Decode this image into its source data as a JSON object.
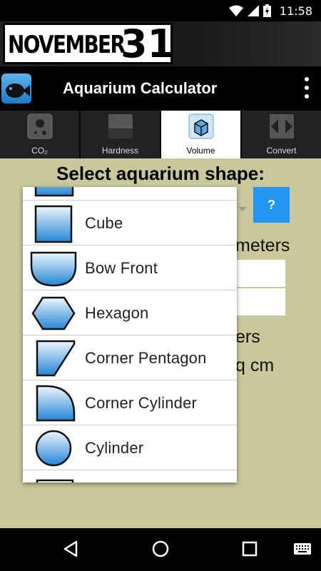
{
  "status_bar": {
    "time": "11:58"
  },
  "banner": {
    "month": "NOVEMBER",
    "day": "31"
  },
  "app_bar": {
    "title": "Aquarium Calculator"
  },
  "tabs": [
    {
      "label": "CO₂",
      "selected": false
    },
    {
      "label": "Hardness",
      "selected": false
    },
    {
      "label": "Volume",
      "selected": true
    },
    {
      "label": "Convert",
      "selected": false
    }
  ],
  "content": {
    "heading": "Select aquarium shape:",
    "help_label": "?",
    "units_text": "meters",
    "area_text_1": "ers",
    "area_text_2": "q cm"
  },
  "shape_dropdown": {
    "options": [
      {
        "label": "Cube",
        "icon": "cube-shape-icon"
      },
      {
        "label": "Bow Front",
        "icon": "bow-front-shape-icon"
      },
      {
        "label": "Hexagon",
        "icon": "hexagon-shape-icon"
      },
      {
        "label": "Corner Pentagon",
        "icon": "corner-pentagon-shape-icon"
      },
      {
        "label": "Corner Cylinder",
        "icon": "corner-cylinder-shape-icon"
      },
      {
        "label": "Cylinder",
        "icon": "cylinder-shape-icon"
      }
    ]
  },
  "colors": {
    "background": "#c8c89c",
    "accent_blue": "#2196f3",
    "shape_fill_top": "#eaf4fc",
    "shape_fill_bottom": "#2a8ad8"
  }
}
